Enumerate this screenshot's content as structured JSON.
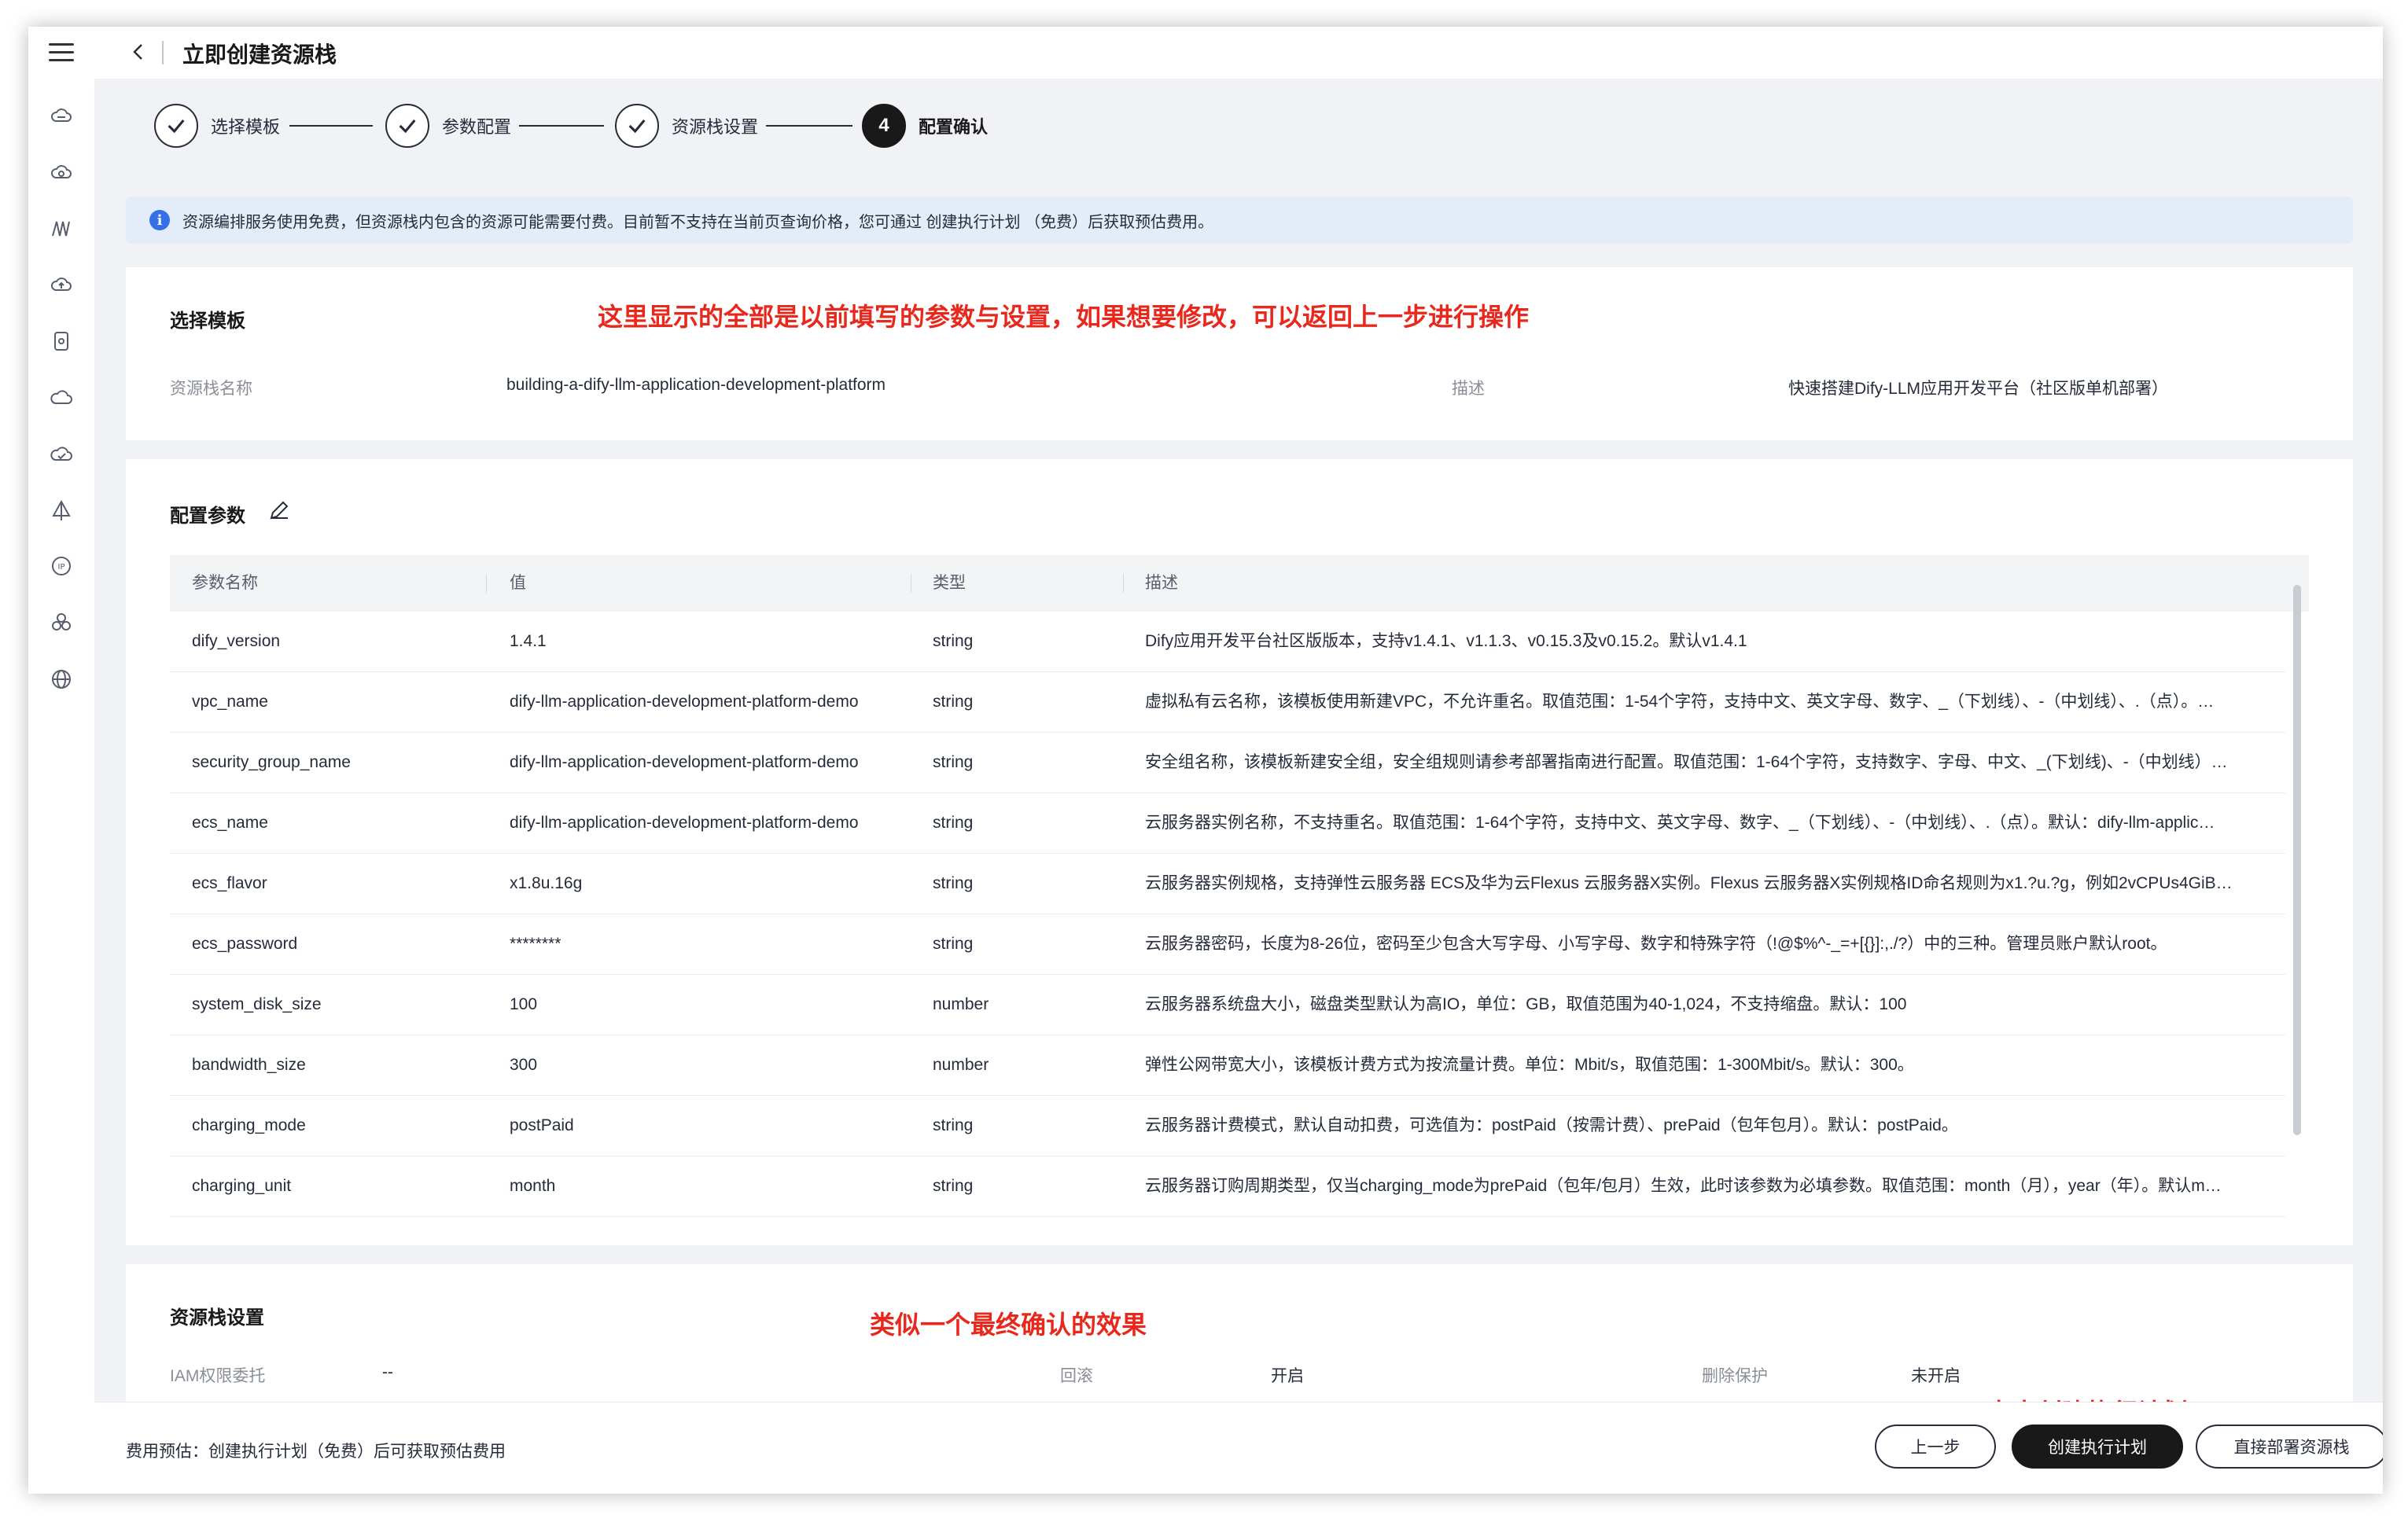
{
  "header": {
    "title": "立即创建资源栈"
  },
  "steps": [
    {
      "label": "选择模板",
      "state": "done"
    },
    {
      "label": "参数配置",
      "state": "done"
    },
    {
      "label": "资源栈设置",
      "state": "done"
    },
    {
      "label": "配置确认",
      "number": "4",
      "state": "active"
    }
  ],
  "banner": {
    "icon": "info-icon",
    "text": "资源编排服务使用免费，但资源栈内包含的资源可能需要付费。目前暂不支持在当前页查询价格，您可通过 创建执行计划 （免费）后获取预估费用。"
  },
  "template_section": {
    "title": "选择模板",
    "note": "这里显示的全部是以前填写的参数与设置，如果想要修改，可以返回上一步进行操作",
    "stack_name_label": "资源栈名称",
    "stack_name_value": "building-a-dify-llm-application-development-platform",
    "desc_label": "描述",
    "desc_value": "快速搭建Dify-LLM应用开发平台（社区版单机部署）"
  },
  "params_section": {
    "title": "配置参数",
    "columns": [
      "参数名称",
      "值",
      "类型",
      "描述"
    ],
    "rows": [
      [
        "dify_version",
        "1.4.1",
        "string",
        "Dify应用开发平台社区版版本，支持v1.4.1、v1.1.3、v0.15.3及v0.15.2。默认v1.4.1"
      ],
      [
        "vpc_name",
        "dify-llm-application-development-platform-demo",
        "string",
        "虚拟私有云名称，该模板使用新建VPC，不允许重名。取值范围：1-54个字符，支持中文、英文字母、数字、_（下划线）、-（中划线）、.（点）。…"
      ],
      [
        "security_group_name",
        "dify-llm-application-development-platform-demo",
        "string",
        "安全组名称，该模板新建安全组，安全组规则请参考部署指南进行配置。取值范围：1-64个字符，支持数字、字母、中文、_(下划线)、-（中划线）…"
      ],
      [
        "ecs_name",
        "dify-llm-application-development-platform-demo",
        "string",
        "云服务器实例名称，不支持重名。取值范围：1-64个字符，支持中文、英文字母、数字、_（下划线）、-（中划线）、.（点）。默认：dify-llm-applic…"
      ],
      [
        "ecs_flavor",
        "x1.8u.16g",
        "string",
        "云服务器实例规格，支持弹性云服务器 ECS及华为云Flexus 云服务器X实例。Flexus 云服务器X实例规格ID命名规则为x1.?u.?g，例如2vCPUs4GiB…"
      ],
      [
        "ecs_password",
        "********",
        "string",
        "云服务器密码，长度为8-26位，密码至少包含大写字母、小写字母、数字和特殊字符（!@$%^-_=+[{}]:,./?）中的三种。管理员账户默认root。"
      ],
      [
        "system_disk_size",
        "100",
        "number",
        "云服务器系统盘大小，磁盘类型默认为高IO，单位：GB，取值范围为40-1,024，不支持缩盘。默认：100"
      ],
      [
        "bandwidth_size",
        "300",
        "number",
        "弹性公网带宽大小，该模板计费方式为按流量计费。单位：Mbit/s，取值范围：1-300Mbit/s。默认：300。"
      ],
      [
        "charging_mode",
        "postPaid",
        "string",
        "云服务器计费模式，默认自动扣费，可选值为：postPaid（按需计费）、prePaid（包年包月）。默认：postPaid。"
      ],
      [
        "charging_unit",
        "month",
        "string",
        "云服务器订购周期类型，仅当charging_mode为prePaid（包年/包月）生效，此时该参数为必填参数。取值范围：month（月），year（年）。默认m…"
      ]
    ]
  },
  "stack_settings": {
    "title": "资源栈设置",
    "note": "类似一个最终确认的效果",
    "iam_label": "IAM权限委托",
    "iam_value": "--",
    "rollback_label": "回滚",
    "rollback_value": "开启",
    "delete_protect_label": "删除保护",
    "delete_protect_value": "未开启"
  },
  "footer_note": "点击创建执行计划",
  "footer": {
    "cost_text": "费用预估：创建执行计划（免费）后可获取预估费用",
    "prev_label": "上一步",
    "plan_label": "创建执行计划",
    "deploy_label": "直接部署资源栈"
  },
  "colors": {
    "annotation": "#e8281c",
    "banner_bg": "#e4ecfa",
    "primary": "#191919",
    "info": "#3670e8"
  }
}
